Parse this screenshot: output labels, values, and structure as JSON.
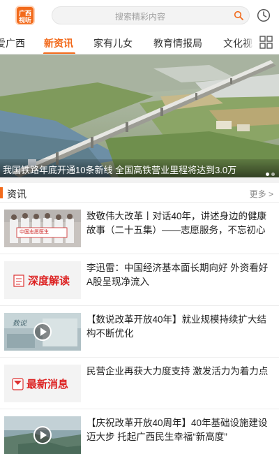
{
  "header": {
    "logo_line1": "广西",
    "logo_line2": "视听",
    "search_placeholder": "搜索精彩内容",
    "search_icon": "search-icon",
    "history_icon": "clock-icon"
  },
  "tabs": [
    {
      "label": "爱广西"
    },
    {
      "label": "新资讯",
      "active": true
    },
    {
      "label": "家有儿女"
    },
    {
      "label": "教育情报局"
    },
    {
      "label": "文化视"
    }
  ],
  "tabs_menu_icon": "grid-icon",
  "banner": {
    "caption": "我国铁路年底开通10条新线 全国高铁营业里程将达到3.0万",
    "slides": 2,
    "active_slide": 1
  },
  "section": {
    "title": "资讯",
    "more": "更多 >"
  },
  "news": [
    {
      "title": "致敬伟大改革丨对话40年，讲述身边的健康故事（二十五集）——志愿服务，不忘初心",
      "thumb": "group-photo",
      "video": false,
      "thumb_text": "中国志愿医生"
    },
    {
      "title": "李迅雷：中国经济基本面长期向好 外资看好A股呈现净流入",
      "thumb": "deep-read",
      "video": false,
      "thumb_text": "深度解读"
    },
    {
      "title": "【数说改革开放40年】就业规模持续扩大结构不断优化",
      "thumb": "video",
      "video": true,
      "thumb_text": "数说"
    },
    {
      "title": "民营企业再获大力度支持 激发活力为着力点",
      "thumb": "latest-news",
      "video": false,
      "thumb_text": "最新消息"
    },
    {
      "title": "【庆祝改革开放40周年】40年基础设施建设迈大步 托起广西民生幸福“新高度”",
      "thumb": "video",
      "video": true,
      "thumb_text": ""
    }
  ],
  "colors": {
    "accent": "#f26a1b"
  }
}
